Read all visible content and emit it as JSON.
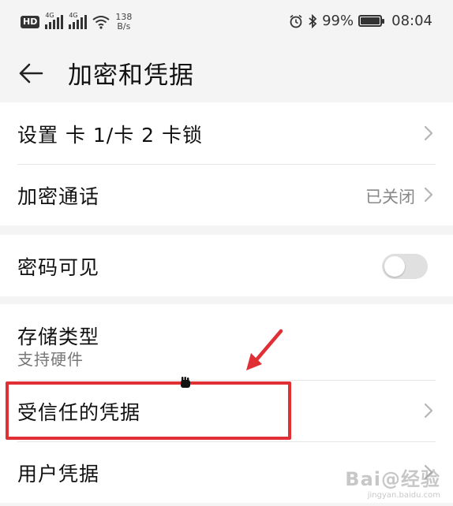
{
  "status_bar": {
    "hd_badge": "HD",
    "sim1_network": "4G",
    "sim2_network": "4G",
    "net_speed_value": "138",
    "net_speed_unit": "B/s",
    "battery_percent": "99%",
    "battery_level": 0.99,
    "time": "08:04",
    "icons": [
      "alarm-icon",
      "bluetooth-icon",
      "wifi-icon",
      "signal-icon",
      "battery-icon"
    ]
  },
  "header": {
    "title": "加密和凭据",
    "back_icon": "back-arrow-icon"
  },
  "groups": [
    {
      "items": [
        {
          "label": "设置 卡 1/卡 2 卡锁",
          "value": "",
          "control": "chevron"
        },
        {
          "label": "加密通话",
          "value": "已关闭",
          "control": "chevron"
        }
      ]
    },
    {
      "items": [
        {
          "label": "密码可见",
          "value": "",
          "control": "toggle",
          "toggle_on": false
        }
      ]
    },
    {
      "items": [
        {
          "label": "存储类型",
          "sub_label": "支持硬件",
          "control": "none"
        },
        {
          "label": "受信任的凭据",
          "value": "",
          "control": "chevron"
        },
        {
          "label": "用户凭据",
          "value": "",
          "control": "chevron"
        }
      ]
    }
  ],
  "colors": {
    "background": "#f4f4f4",
    "card": "#ffffff",
    "annotation_red": "#e03036",
    "secondary_text": "#888888",
    "toggle_off": "#e0e0e0"
  },
  "watermark": {
    "logo": "Bai@经验",
    "url": "jingyan.baidu.com"
  }
}
